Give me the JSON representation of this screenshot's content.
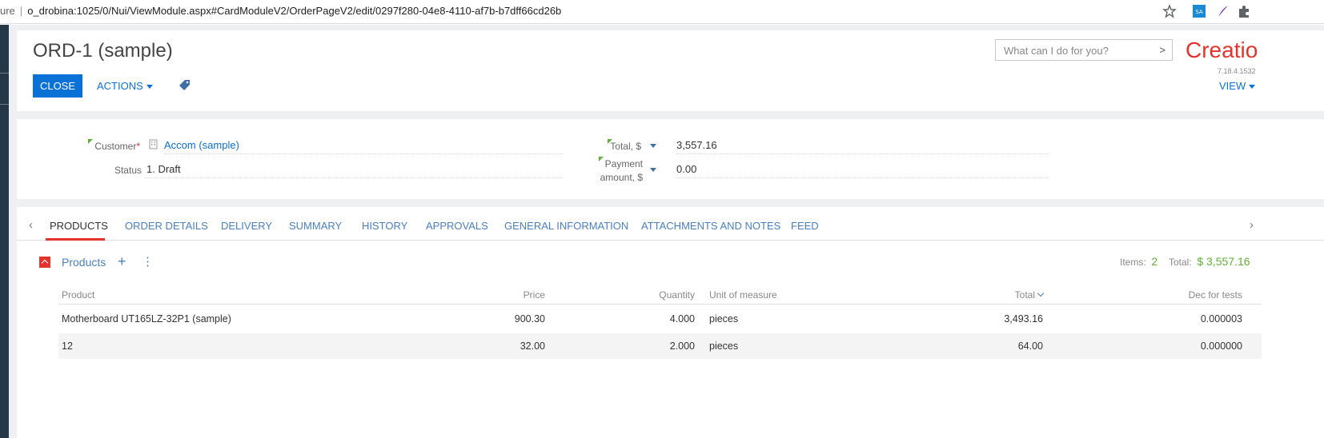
{
  "browser": {
    "url_prefix": "ure",
    "url": "o_drobina:1025/0/Nui/ViewModule.aspx#CardModuleV2/OrderPageV2/edit/0297f280-04e8-4110-af7b-b7dff66cd26b"
  },
  "header": {
    "title": "ORD-1 (sample)",
    "close_label": "CLOSE",
    "actions_label": "ACTIONS",
    "search_placeholder": "What can I do for you?",
    "logo_text": "Creatio",
    "version": "7.18.4.1532",
    "view_label": "VIEW"
  },
  "info": {
    "customer_label": "Customer",
    "customer_value": "Accom (sample)",
    "status_label": "Status",
    "status_value": "1. Draft",
    "total_label": "Total, $",
    "total_value": "3,557.16",
    "payment_label_1": "Payment",
    "payment_label_2": "amount, $",
    "payment_value": "0.00"
  },
  "tabs": [
    "PRODUCTS",
    "ORDER DETAILS",
    "DELIVERY",
    "SUMMARY",
    "HISTORY",
    "APPROVALS",
    "GENERAL INFORMATION",
    "ATTACHMENTS AND NOTES",
    "FEED"
  ],
  "products": {
    "section_title": "Products",
    "items_label": "Items:",
    "items_count": "2",
    "total_label": "Total:",
    "total_value": "$ 3,557.16",
    "columns": [
      "Product",
      "Price",
      "Quantity",
      "Unit of measure",
      "Total",
      "Dec for tests"
    ],
    "rows": [
      [
        "Motherboard UT165LZ-32P1 (sample)",
        "900.30",
        "4.000",
        "pieces",
        "3,493.16",
        "0.000003"
      ],
      [
        "12",
        "32.00",
        "2.000",
        "pieces",
        "64.00",
        "0.000000"
      ]
    ]
  },
  "colors": {
    "accent_blue": "#0a71d6",
    "brand_red": "#e4332c",
    "positive_green": "#5fb235"
  }
}
